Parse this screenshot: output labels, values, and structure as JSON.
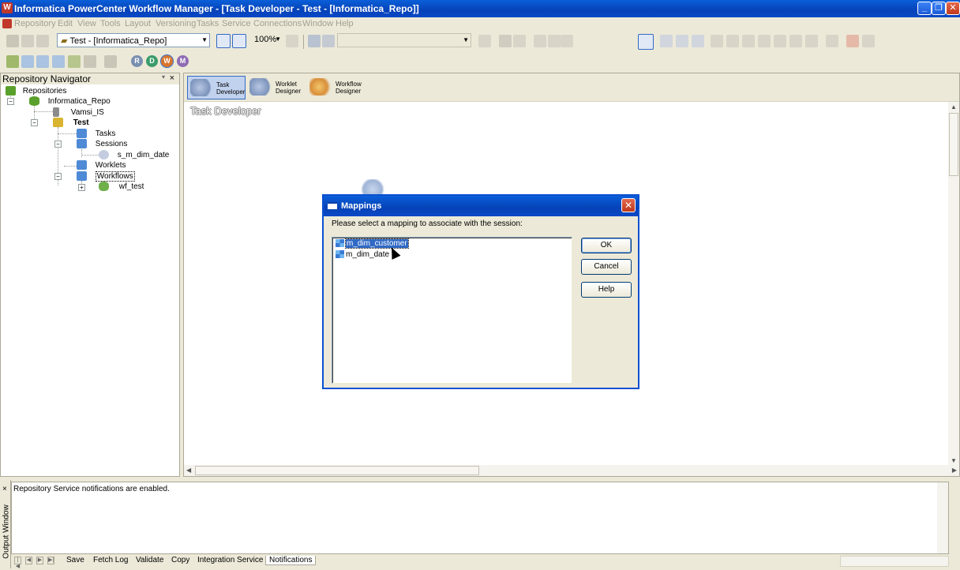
{
  "window": {
    "title": "Informatica PowerCenter Workflow Manager - [Task Developer - Test - [Informatica_Repo]]",
    "minimize": "_",
    "restore": "❐",
    "close": "✕"
  },
  "menu": {
    "items": [
      "Repository",
      "Edit",
      "View",
      "Tools",
      "Layout",
      "Versioning",
      "Tasks",
      "Service",
      "Connections",
      "Window",
      "Help"
    ]
  },
  "toolbar": {
    "folder_combo": "Test - [Informatica_Repo]",
    "zoom_combo": "100%",
    "mode_buttons": [
      "R",
      "D",
      "W",
      "M"
    ]
  },
  "navigator": {
    "title": "Repository Navigator",
    "close": "×",
    "tree": {
      "root": "Repositories",
      "repo": "Informatica_Repo",
      "service": "Vamsi_IS",
      "folder": "Test",
      "tasks": "Tasks",
      "sessions": "Sessions",
      "session_item": "s_m_dim_date",
      "worklets": "Worklets",
      "workflows": "Workflows",
      "workflow_item": "wf_test"
    }
  },
  "workspace": {
    "tabs": [
      {
        "label_line1": "Task",
        "label_line2": "Developer"
      },
      {
        "label_line1": "Worklet",
        "label_line2": "Designer"
      },
      {
        "label_line1": "Workflow",
        "label_line2": "Designer"
      }
    ],
    "canvas_title": "Task Developer"
  },
  "dialog": {
    "title": "Mappings",
    "prompt": "Please select a mapping to associate with the session:",
    "mappings": [
      "m_dim_customer",
      "m_dim_date"
    ],
    "selected_index": 0,
    "ok_label": "OK",
    "cancel_label": "Cancel",
    "help_label": "Help",
    "close": "✕"
  },
  "output": {
    "side_label": "Output Window",
    "message": "Repository Service notifications are enabled.",
    "tabs": [
      "Save",
      "Fetch Log",
      "Validate",
      "Copy",
      "Integration Service",
      "Notifications"
    ],
    "active_tab": "Notifications"
  }
}
